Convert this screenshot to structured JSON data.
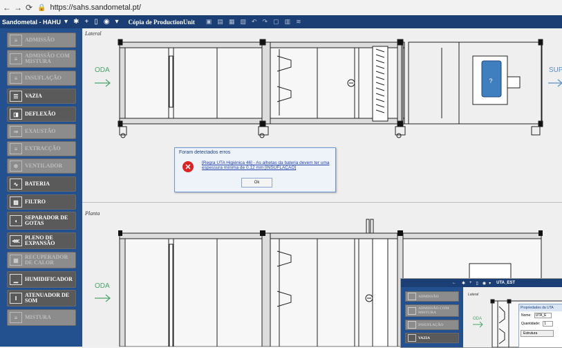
{
  "browser": {
    "url": "https://sahs.sandometal.pt/"
  },
  "app": {
    "name": "Sandometal - HAHU",
    "project_title": "Cópia de ProductionUnit"
  },
  "sidebar": {
    "items": [
      {
        "label": "ADMISSÃO",
        "enabled": false
      },
      {
        "label": "ADMISSÃO COM MISTURA",
        "enabled": false
      },
      {
        "label": "INSUFLAÇÃO",
        "enabled": false
      },
      {
        "label": "VAZIA",
        "enabled": true
      },
      {
        "label": "DEFLEXÃO",
        "enabled": true
      },
      {
        "label": "EXAUSTÃO",
        "enabled": false
      },
      {
        "label": "EXTRACÇÃO",
        "enabled": false
      },
      {
        "label": "VENTILADOR",
        "enabled": false
      },
      {
        "label": "BATERIA",
        "enabled": true
      },
      {
        "label": "FILTRO",
        "enabled": true
      },
      {
        "label": "SEPARADOR DE GOTAS",
        "enabled": true
      },
      {
        "label": "PLENO DE EXPANSÃO",
        "enabled": true
      },
      {
        "label": "RECUPERADOR DE CALOR",
        "enabled": false
      },
      {
        "label": "HUMIDIFICADOR",
        "enabled": true
      },
      {
        "label": "ATENUADOR DE SOM",
        "enabled": true
      },
      {
        "label": "MISTURA",
        "enabled": false
      }
    ]
  },
  "canvas": {
    "lateral_label": "Lateral",
    "planta_label": "Planta",
    "oda_label": "ODA",
    "sup_label": "SUP",
    "fan_mark": "?"
  },
  "error_dialog": {
    "title": "Foram detectados erros",
    "message": "[Regra UTA Higiénica 46] - As alhetas da bateria devem ter uma espessura mínima de 0.12 mm [INSUFLAÇÃO]",
    "ok_label": "Ok"
  },
  "inset": {
    "toolbar_title": "UTA_EST",
    "lateral_label": "Lateral",
    "oda_label": "ODA",
    "sidebar_items": [
      {
        "label": "ADMISSÃO",
        "enabled": false
      },
      {
        "label": "ADMISSÃO COM MISTURA",
        "enabled": false
      },
      {
        "label": "INSUFLAÇÃO",
        "enabled": false
      },
      {
        "label": "VAZIA",
        "enabled": true
      }
    ],
    "properties": {
      "title": "Propriedades da UTA",
      "name_label": "Nome:",
      "name_value": "UTA_E",
      "qty_label": "Quantidade:",
      "qty_value": "1",
      "tab_label": "Estrutura"
    }
  },
  "colors": {
    "toolbar": "#1b3f74",
    "sidebar": "#23508f",
    "oda": "#4aa56a",
    "fan": "#3f7fbf",
    "error": "#dd2222"
  }
}
